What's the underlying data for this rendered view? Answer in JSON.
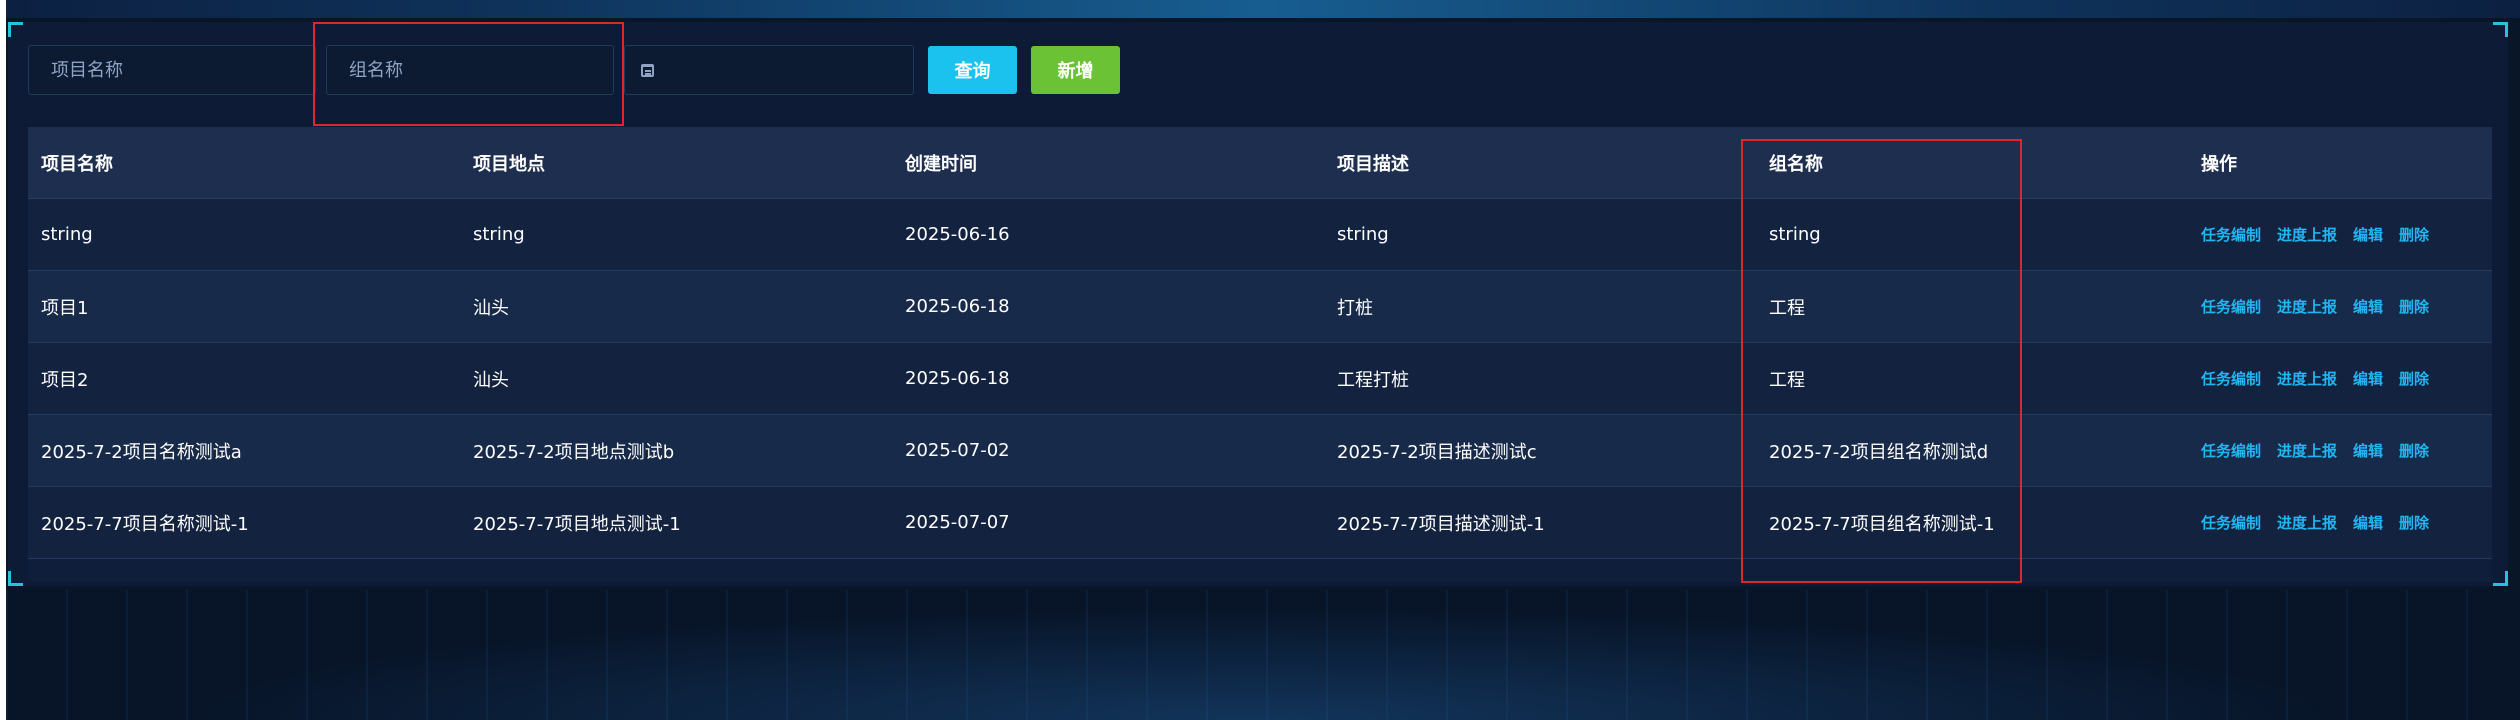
{
  "filters": {
    "project_name_placeholder": "项目名称",
    "group_name_placeholder": "组名称",
    "date_placeholder": ""
  },
  "buttons": {
    "query": "查询",
    "add": "新增"
  },
  "table": {
    "headers": {
      "project_name": "项目名称",
      "location": "项目地点",
      "created": "创建时间",
      "description": "项目描述",
      "group_name": "组名称",
      "actions": "操作"
    },
    "rows": [
      {
        "project_name": "string",
        "location": "string",
        "created": "2025-06-16",
        "description": "string",
        "group_name": "string"
      },
      {
        "project_name": "项目1",
        "location": "汕头",
        "created": "2025-06-18",
        "description": "打桩",
        "group_name": "工程"
      },
      {
        "project_name": "项目2",
        "location": "汕头",
        "created": "2025-06-18",
        "description": "工程打桩",
        "group_name": "工程"
      },
      {
        "project_name": "2025-7-2项目名称测试a",
        "location": "2025-7-2项目地点测试b",
        "created": "2025-07-02",
        "description": "2025-7-2项目描述测试c",
        "group_name": "2025-7-2项目组名称测试d"
      },
      {
        "project_name": "2025-7-7项目名称测试-1",
        "location": "2025-7-7项目地点测试-1",
        "created": "2025-07-07",
        "description": "2025-7-7项目描述测试-1",
        "group_name": "2025-7-7项目组名称测试-1"
      }
    ],
    "row_actions": {
      "task_edit": "任务编制",
      "progress_report": "进度上报",
      "edit": "编辑",
      "delete": "删除"
    }
  },
  "colors": {
    "highlight_box": "#e0262d",
    "query_button": "#1cc2ee",
    "add_button": "#6bc235",
    "action_link": "#1fb6f2"
  }
}
